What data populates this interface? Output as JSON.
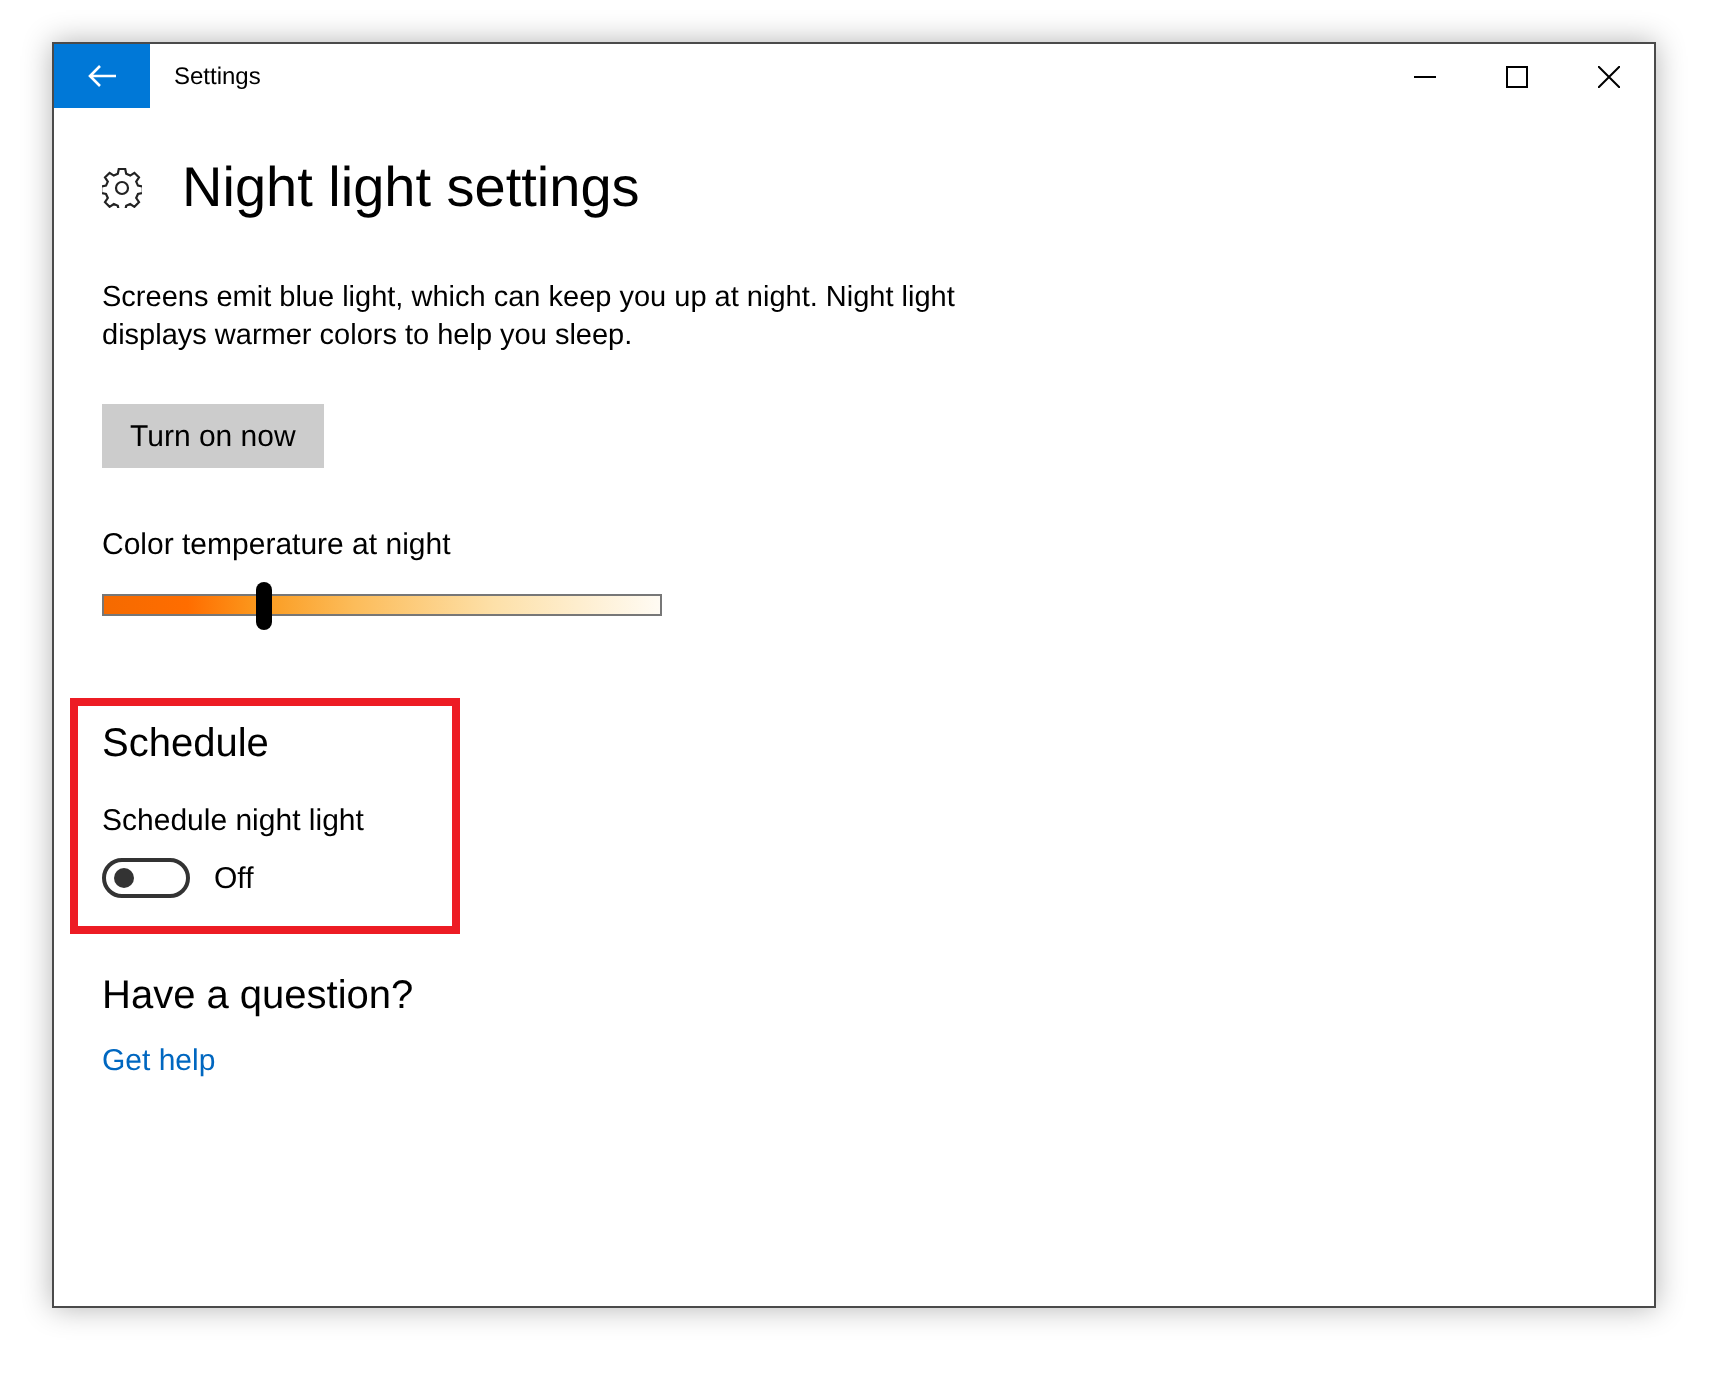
{
  "window": {
    "title": "Settings"
  },
  "page": {
    "title": "Night light settings",
    "description": "Screens emit blue light, which can keep you up at night. Night light displays warmer colors to help you sleep.",
    "button": "Turn on now"
  },
  "color_temperature": {
    "label": "Color temperature at night",
    "level": 0.29
  },
  "schedule": {
    "title": "Schedule",
    "highlighted": true,
    "toggle_label": "Schedule night light",
    "on": false,
    "state_text": "Off"
  },
  "help": {
    "title": "Have a question?",
    "link": "Get help"
  }
}
